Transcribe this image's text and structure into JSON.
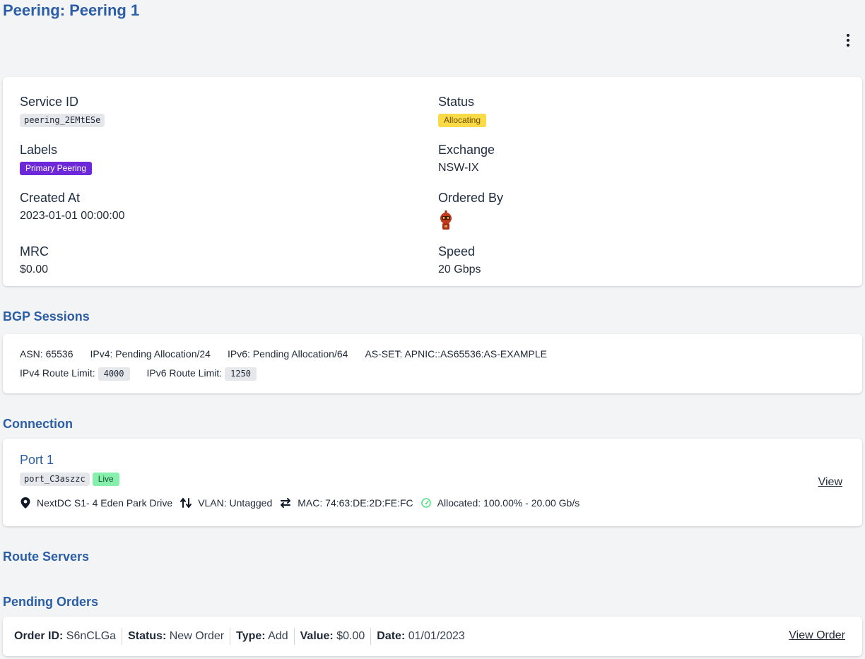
{
  "page": {
    "title": "Peering: Peering 1"
  },
  "details": {
    "service_id": {
      "label": "Service ID",
      "value": "peering_2EMtESe"
    },
    "status": {
      "label": "Status",
      "value": "Allocating"
    },
    "labels": {
      "label": "Labels",
      "value": "Primary Peering"
    },
    "exchange": {
      "label": "Exchange",
      "value": "NSW-IX"
    },
    "created_at": {
      "label": "Created At",
      "value": "2023-01-01 00:00:00"
    },
    "ordered_by": {
      "label": "Ordered By",
      "avatar_icon": "robot-avatar-icon"
    },
    "mrc": {
      "label": "MRC",
      "value": "$0.00"
    },
    "speed": {
      "label": "Speed",
      "value": "20 Gbps"
    }
  },
  "bgp": {
    "title": "BGP Sessions",
    "asn": "ASN: 65536",
    "ipv4": "IPv4: Pending Allocation/24",
    "ipv6": "IPv6: Pending Allocation/64",
    "as_set": "AS-SET: APNIC::AS65536:AS-EXAMPLE",
    "ipv4_limit_label": "IPv4 Route Limit:",
    "ipv4_limit_value": "4000",
    "ipv6_limit_label": "IPv6 Route Limit:",
    "ipv6_limit_value": "1250"
  },
  "connection": {
    "title": "Connection",
    "port_name": "Port 1",
    "port_id": "port_C3aszzc",
    "port_status": "Live",
    "location": "NextDC S1- 4 Eden Park Drive",
    "vlan": "VLAN: Untagged",
    "mac": "MAC: 74:63:DE:2D:FE:FC",
    "allocated": "Allocated: 100.00% - 20.00 Gb/s",
    "view_label": "View"
  },
  "route_servers": {
    "title": "Route Servers"
  },
  "pending_orders": {
    "title": "Pending Orders",
    "order_id_label": "Order ID:",
    "order_id": "S6nCLGa",
    "status_label": "Status:",
    "status": "New Order",
    "type_label": "Type:",
    "type": "Add",
    "value_label": "Value:",
    "value": "$0.00",
    "date_label": "Date:",
    "date": "01/01/2023",
    "view_label": "View Order"
  },
  "colors": {
    "heading": "#2b5ea7",
    "allocating_badge": "#fadb47",
    "label_badge": "#6d28d9",
    "live_badge": "#86efac",
    "allocated_icon": "#4ade80"
  }
}
